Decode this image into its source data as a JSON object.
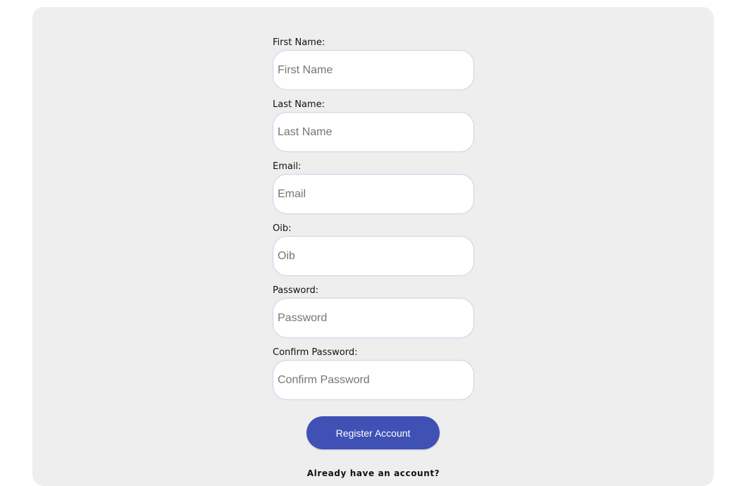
{
  "form": {
    "fields": [
      {
        "label": "First Name:",
        "placeholder": "First Name",
        "value": ""
      },
      {
        "label": "Last Name:",
        "placeholder": "Last Name",
        "value": ""
      },
      {
        "label": "Email:",
        "placeholder": "Email",
        "value": ""
      },
      {
        "label": "Oib:",
        "placeholder": "Oib",
        "value": ""
      },
      {
        "label": "Password:",
        "placeholder": "Password",
        "value": ""
      },
      {
        "label": "Confirm Password:",
        "placeholder": "Confirm Password",
        "value": ""
      }
    ],
    "submit_label": "Register Account",
    "login_prompt": "Already have an account?"
  },
  "colors": {
    "card_background": "#eeeeee",
    "input_border": "#cfd0ea",
    "button_background": "#3f51b5",
    "button_text": "#ffffff"
  }
}
